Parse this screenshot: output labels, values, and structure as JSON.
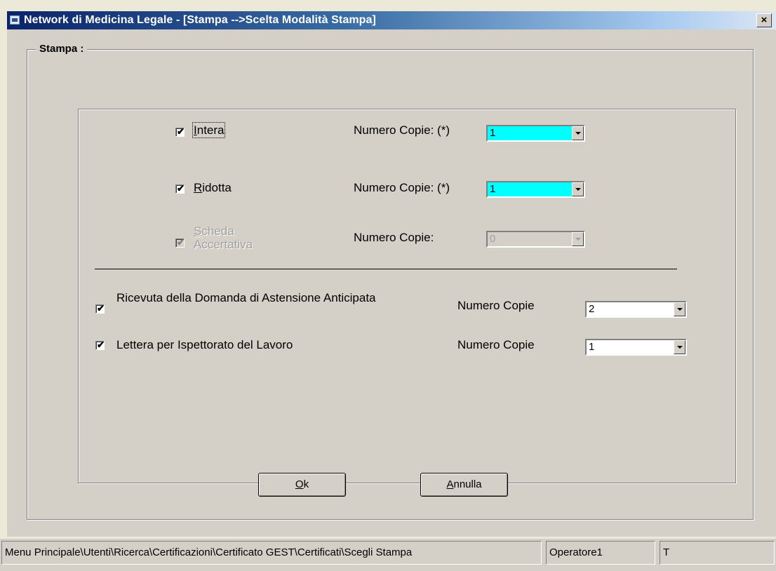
{
  "window": {
    "title": "Network di Medicina Legale - [Stampa -->Scelta Modalità Stampa]",
    "close_label": "×"
  },
  "group": {
    "legend": "Stampa :"
  },
  "rows": {
    "intera": {
      "access_key": "I",
      "label_rest": "ntera",
      "checked": true,
      "copies_label": "Numero Copie: (*)",
      "copies_value": "1"
    },
    "ridotta": {
      "access_key": "R",
      "label_rest": "idotta",
      "checked": true,
      "copies_label": "Numero Copie: (*)",
      "copies_value": "1"
    },
    "scheda": {
      "access_key": "S",
      "label_rest": "cheda",
      "label_line2": "Accertativa",
      "checked": true,
      "enabled": false,
      "copies_label": "Numero Copie:",
      "copies_value": "0"
    },
    "ricevuta": {
      "label": "Ricevuta della Domanda di Astensione Anticipata",
      "checked": true,
      "copies_label": "Numero Copie",
      "copies_value": "2"
    },
    "lettera": {
      "label": "Lettera per Ispettorato del Lavoro",
      "checked": true,
      "copies_label": "Numero Copie",
      "copies_value": "1"
    }
  },
  "buttons": {
    "ok_key": "O",
    "ok_rest": "k",
    "annulla_key": "A",
    "annulla_rest": "nnulla"
  },
  "statusbar": {
    "path": "Menu Principale\\Utenti\\Ricerca\\Certificazioni\\Certificato GEST\\Certificati\\Scegli Stampa",
    "operator": "Operatore1",
    "flag": "T"
  },
  "colors": {
    "title_gradient_start": "#0a246a",
    "combo_highlight": "#00ffff",
    "face": "#d4d0c8"
  }
}
